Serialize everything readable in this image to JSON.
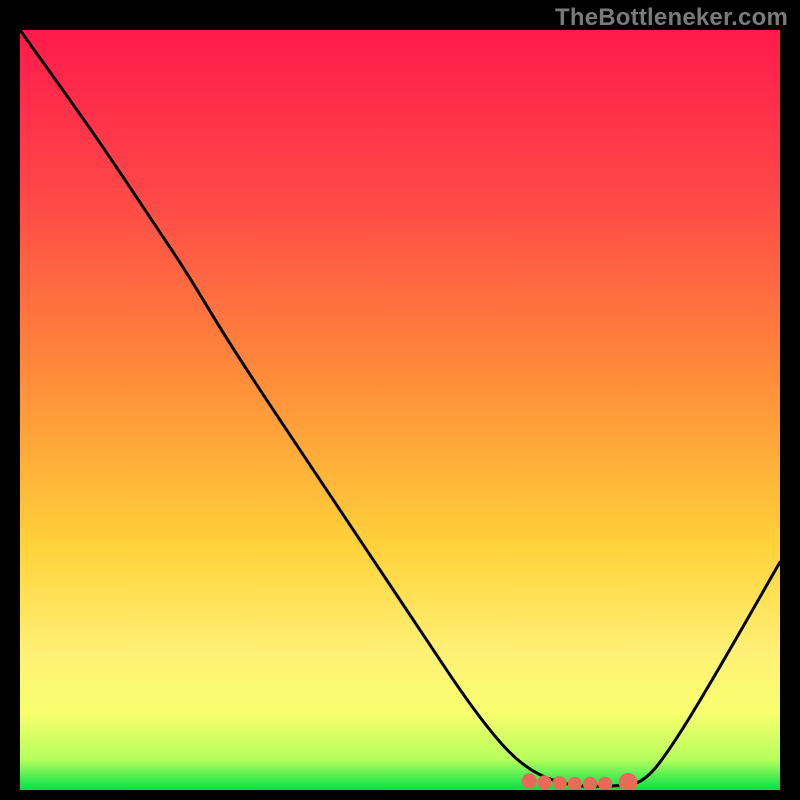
{
  "watermark": "TheBottleneker.com",
  "chart_data": {
    "type": "line",
    "title": "",
    "xlabel": "",
    "ylabel": "",
    "xlim": [
      0,
      100
    ],
    "ylim": [
      0,
      100
    ],
    "gradient_stops": [
      {
        "offset": 0,
        "color": "#ff1a4b"
      },
      {
        "offset": 22,
        "color": "#ff4848"
      },
      {
        "offset": 45,
        "color": "#ff8a3a"
      },
      {
        "offset": 68,
        "color": "#ffd23a"
      },
      {
        "offset": 82,
        "color": "#fff176"
      },
      {
        "offset": 90,
        "color": "#f7ff6e"
      },
      {
        "offset": 96,
        "color": "#b6ff5c"
      },
      {
        "offset": 100,
        "color": "#00e04a"
      }
    ],
    "curve": [
      {
        "x": 0,
        "y": 100
      },
      {
        "x": 10,
        "y": 86
      },
      {
        "x": 18,
        "y": 74
      },
      {
        "x": 22,
        "y": 68
      },
      {
        "x": 28,
        "y": 58
      },
      {
        "x": 40,
        "y": 40
      },
      {
        "x": 52,
        "y": 22
      },
      {
        "x": 60,
        "y": 10
      },
      {
        "x": 66,
        "y": 3
      },
      {
        "x": 72,
        "y": 0.5
      },
      {
        "x": 78,
        "y": 0.5
      },
      {
        "x": 82,
        "y": 0.8
      },
      {
        "x": 86,
        "y": 6
      },
      {
        "x": 92,
        "y": 16
      },
      {
        "x": 100,
        "y": 30
      }
    ],
    "markers": [
      {
        "x": 67,
        "y": 1.2,
        "r": 1.0
      },
      {
        "x": 69,
        "y": 1.0,
        "r": 0.9
      },
      {
        "x": 71,
        "y": 0.9,
        "r": 0.9
      },
      {
        "x": 73,
        "y": 0.8,
        "r": 0.9
      },
      {
        "x": 75,
        "y": 0.8,
        "r": 0.9
      },
      {
        "x": 77,
        "y": 0.8,
        "r": 0.9
      },
      {
        "x": 80,
        "y": 1.0,
        "r": 1.4
      }
    ],
    "marker_color": "#e86a5a"
  }
}
